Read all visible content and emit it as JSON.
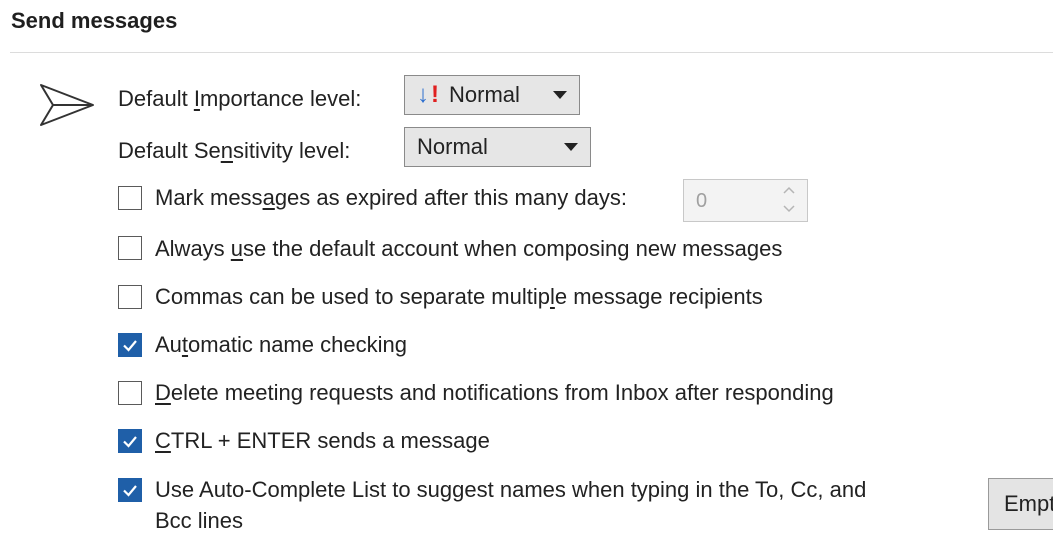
{
  "section": {
    "title": "Send messages"
  },
  "importance": {
    "label": "Default Importance level:",
    "label_parts": [
      "Default ",
      "I",
      "mportance level:"
    ],
    "value": "Normal",
    "icon": "low-high-importance-icon"
  },
  "sensitivity": {
    "label": "Default Sensitivity level:",
    "label_parts": [
      "Default Se",
      "n",
      "sitivity level:"
    ],
    "value": "Normal"
  },
  "options": [
    {
      "label": "Mark messages as expired after this many days:",
      "parts": [
        "Mark mess",
        "a",
        "ges as expired after this many days:"
      ],
      "checked": false
    },
    {
      "label": "Always use the default account when composing new messages",
      "parts": [
        "Always ",
        "u",
        "se the default account when composing new messages"
      ],
      "checked": false
    },
    {
      "label": "Commas can be used to separate multiple message recipients",
      "parts": [
        "Commas can be used to separate multip",
        "l",
        "e message recipients"
      ],
      "checked": false
    },
    {
      "label": "Automatic name checking",
      "parts": [
        "Au",
        "t",
        "omatic name checking"
      ],
      "checked": true
    },
    {
      "label": "Delete meeting requests and notifications from Inbox after responding",
      "parts": [
        "",
        "D",
        "elete meeting requests and notifications from Inbox after responding"
      ],
      "checked": false
    },
    {
      "label": "CTRL + ENTER sends a message",
      "parts": [
        "",
        "C",
        "TRL + ENTER sends a message"
      ],
      "checked": true
    },
    {
      "label": "Use Auto-Complete List to suggest names when typing in the To, Cc, and Bcc lines",
      "line1": "Use Auto-Complete List to suggest names when typing in the To, Cc, and",
      "line2": "Bcc lines",
      "checked": true
    }
  ],
  "expire_days": {
    "value": "0",
    "disabled": true
  },
  "empty_button": {
    "label": "Empty Auto-Complete List",
    "visible_label": "Empt",
    "underlined_char": "y"
  },
  "colors": {
    "checkbox_checked": "#1f5fa8",
    "importance_arrow": "#2d6fcf",
    "importance_exclaim": "#e02020"
  }
}
